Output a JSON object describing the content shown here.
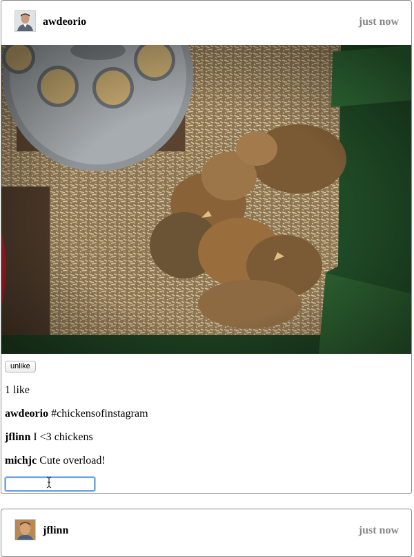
{
  "posts": [
    {
      "owner": "awdeorio",
      "timestamp": "just now",
      "like_button": "unlike",
      "likes_text": "1 like",
      "comments": [
        {
          "owner": "awdeorio",
          "text": "#chickensofinstagram"
        },
        {
          "owner": "jflinn",
          "text": "I <3 chickens"
        },
        {
          "owner": "michjc",
          "text": "Cute overload!"
        }
      ],
      "comment_input": {
        "value": ""
      }
    },
    {
      "owner": "jflinn",
      "timestamp": "just now"
    }
  ],
  "icons": {
    "avatar1": "avatar-icon",
    "avatar2": "avatar-icon",
    "cursor": "text-cursor-icon"
  },
  "colors": {
    "timestamp": "#888888",
    "input_focus": "#6fa4e0",
    "border": "#8a8a8a"
  }
}
